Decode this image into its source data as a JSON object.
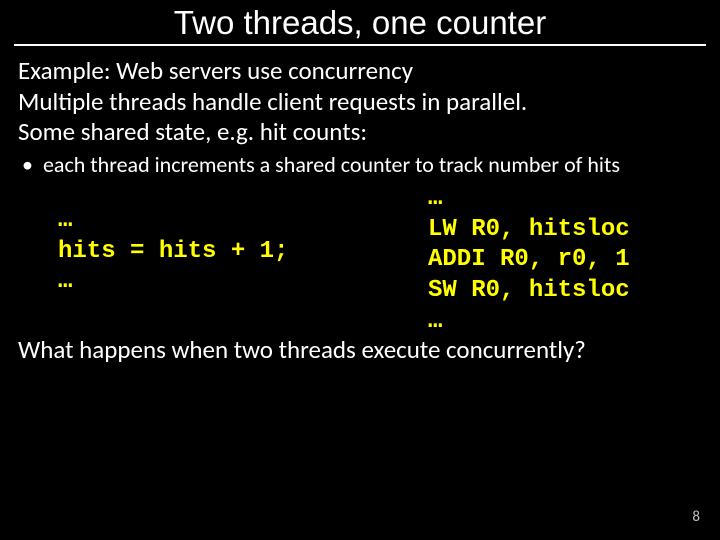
{
  "title": "Two threads, one counter",
  "body": {
    "line1": "Example: Web servers use concurrency",
    "line2": "Multiple threads handle client requests in parallel.",
    "line3": "Some shared state, e.g. hit counts:"
  },
  "bullet": {
    "dot": "•",
    "text": "each thread increments a shared counter to track number of hits"
  },
  "code_left": "…\nhits = hits + 1;\n…",
  "code_right": "…\nLW R0, hitsloc\nADDI R0, r0, 1\nSW R0, hitsloc\n…",
  "closing": "What happens when two threads execute concurrently?",
  "page_number": "8"
}
